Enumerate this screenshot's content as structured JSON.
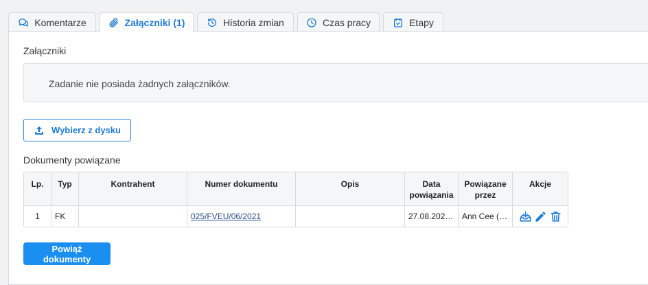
{
  "tabs": [
    {
      "label": "Komentarze",
      "icon": "comments-icon"
    },
    {
      "label": "Załączniki (1)",
      "icon": "paperclip-icon",
      "active": true
    },
    {
      "label": "Historia zmian",
      "icon": "history-icon"
    },
    {
      "label": "Czas pracy",
      "icon": "clock-icon"
    },
    {
      "label": "Etapy",
      "icon": "calendar-check-icon"
    }
  ],
  "attachments": {
    "label": "Załączniki",
    "empty_text": "Zadanie nie posiada żadnych załączników.",
    "upload_label": "Wybierz z dysku"
  },
  "related": {
    "label": "Dokumenty powiązane",
    "columns": [
      "Lp.",
      "Typ",
      "Kontrahent",
      "Numer dokumentu",
      "Opis",
      "Data powiązania",
      "Powiązane przez",
      "Akcje"
    ],
    "rows": [
      {
        "lp": "1",
        "typ": "FK",
        "kontrahent": "",
        "numer": "025/FVEU/06/2021",
        "opis": "",
        "data": "27.08.2021...",
        "przez": "Ann Cee (a..."
      }
    ],
    "link_action_label": "Powiąż dokumenty"
  },
  "colors": {
    "accent": "#1e7bd6",
    "primary_button": "#1b8ef2",
    "link": "#2b4f8a"
  }
}
